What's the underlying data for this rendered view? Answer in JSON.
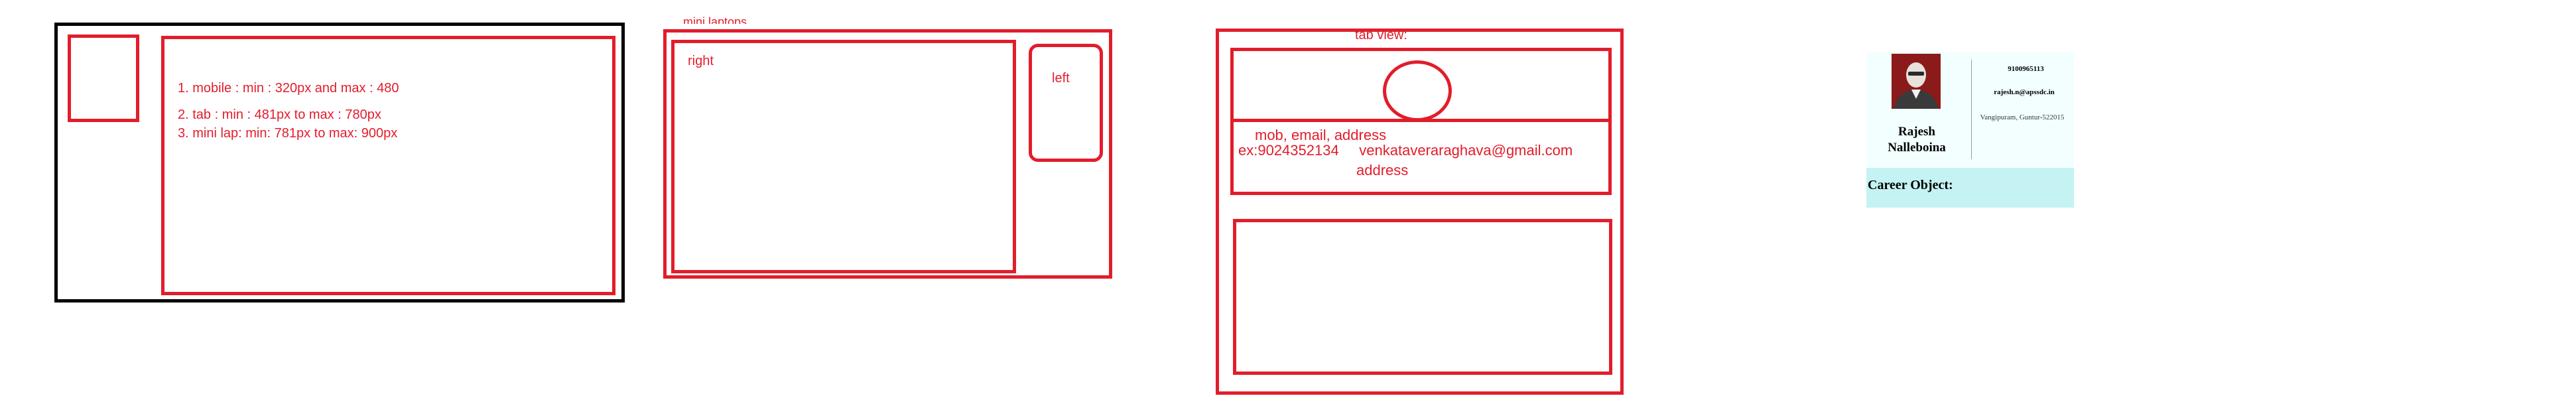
{
  "colors": {
    "accent": "#e21d2b",
    "outline": "#000000",
    "card_band": "#c5f3f3",
    "card_top": "#f3ffff",
    "avatar_bg": "#8b1a1a"
  },
  "panel1": {
    "items": [
      "1. mobile : min  : 320px   and max : 480",
      "2. tab : min : 481px to max : 780px",
      "3. mini lap:  min: 781px to  max: 900px"
    ]
  },
  "panel2": {
    "title": "mini laptops",
    "right_label": "right",
    "left_label": "left"
  },
  "panel3": {
    "title": "tab view:",
    "line1": "mob, email, address",
    "line2": "ex:9024352134     venkataveraraghava@gmail.com",
    "line3": "address"
  },
  "card": {
    "name": "Rajesh Nalleboina",
    "phone": "9100965113",
    "email": "rajesh.n@apssdc.in",
    "address": "Vangipuram, Guntur-522015",
    "section_title": "Career Object:",
    "avatar_icon": "person-photo"
  }
}
